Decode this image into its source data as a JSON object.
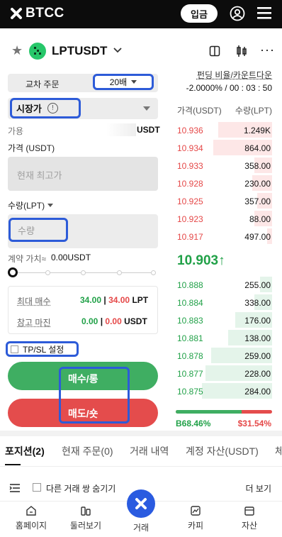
{
  "header": {
    "brand": "BTCC",
    "login_label": "입금"
  },
  "symbol": {
    "name": "LPTUSDT"
  },
  "funding": {
    "label": "펀딩 비율/카운트다운",
    "value": "-2.0000% / 00 : 03 : 50"
  },
  "order": {
    "margin_mode": "교차 주문",
    "leverage": "20배",
    "order_type": "시장가",
    "available_label": "가용",
    "available_unit": "USDT",
    "price_label": "가격 (USDT)",
    "price_placeholder": "현재 최고가",
    "qty_label": "수량(LPT)",
    "qty_placeholder": "수량",
    "contract_value_label": "계약 가치≈",
    "contract_value": "0.00USDT",
    "max_buy_label": "최대 매수",
    "max_buy_green": "34.00",
    "max_buy_red": "34.00",
    "max_buy_unit": "LPT",
    "ref_margin_label": "참고 마진",
    "ref_margin_green": "0.00",
    "ref_margin_red": "0.00",
    "ref_margin_unit": "USDT",
    "sep": "|",
    "tpsl_label": "TP/SL 설정",
    "buy_label": "매수/롱",
    "sell_label": "매도/숏"
  },
  "orderbook": {
    "col_price": "가격(USDT)",
    "col_qty": "수량(LPT)",
    "asks": [
      {
        "price": "10.936",
        "qty": "1.249K",
        "depth": 0.55
      },
      {
        "price": "10.934",
        "qty": "864.00",
        "depth": 0.6
      },
      {
        "price": "10.933",
        "qty": "358.00",
        "depth": 0.18
      },
      {
        "price": "10.928",
        "qty": "230.00",
        "depth": 0.2
      },
      {
        "price": "10.925",
        "qty": "357.00",
        "depth": 0.15
      },
      {
        "price": "10.923",
        "qty": "88.00",
        "depth": 0.18
      },
      {
        "price": "10.917",
        "qty": "497.00",
        "depth": 0.05
      }
    ],
    "last_price": "10.903",
    "last_arrow": "↑",
    "bids": [
      {
        "price": "10.888",
        "qty": "255.00",
        "depth": 0.12
      },
      {
        "price": "10.884",
        "qty": "338.00",
        "depth": 0.18
      },
      {
        "price": "10.883",
        "qty": "176.00",
        "depth": 0.38
      },
      {
        "price": "10.881",
        "qty": "138.00",
        "depth": 0.45
      },
      {
        "price": "10.878",
        "qty": "259.00",
        "depth": 0.62
      },
      {
        "price": "10.877",
        "qty": "228.00",
        "depth": 0.68
      },
      {
        "price": "10.875",
        "qty": "284.00",
        "depth": 0.72
      }
    ],
    "buy_ratio": "B68.46%",
    "sell_ratio": "$31.54%",
    "buy_pct": 68.46
  },
  "tabs": [
    "포지션(2)",
    "현재 주문(0)",
    "거래 내역",
    "계정 자산(USDT)",
    "체"
  ],
  "list_bar": {
    "hide_label": "다른 거래 쌍 숨기기",
    "more_label": "더 보기"
  },
  "nav": [
    "홈페이지",
    "둘러보기",
    "거래",
    "카피",
    "자산"
  ],
  "colors": {
    "buy": "#3fae62",
    "sell": "#e44c4c",
    "highlight": "#2d5bd8"
  }
}
